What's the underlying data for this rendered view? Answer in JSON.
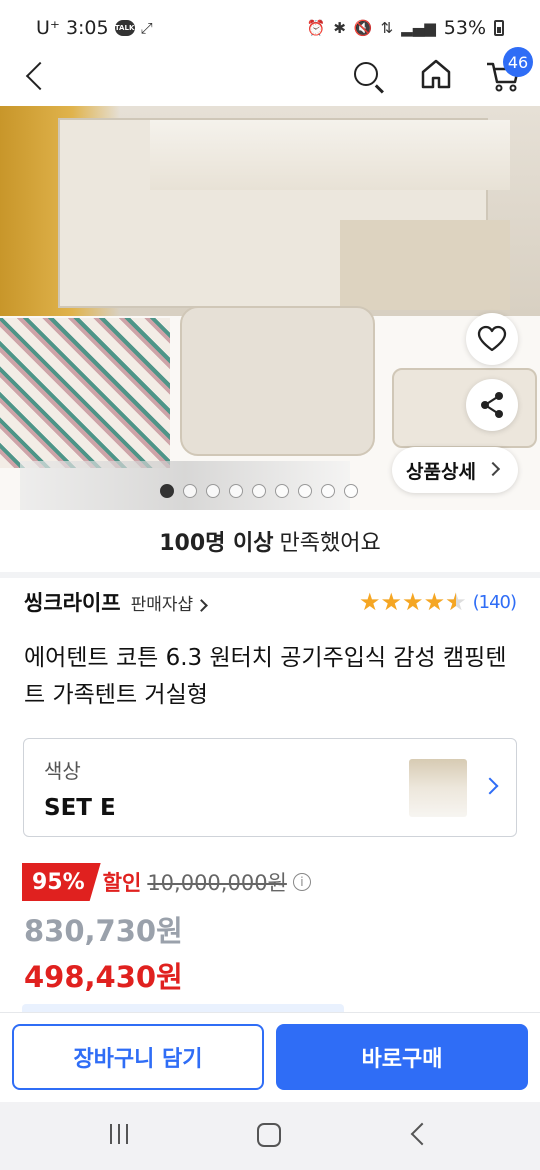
{
  "status_bar": {
    "carrier": "U⁺",
    "time": "3:05",
    "talk_icon_text": "TALK",
    "battery": "53%"
  },
  "header": {
    "cart_count": "46"
  },
  "gallery": {
    "detail_label": "상품상세",
    "dots_total": 9,
    "dots_active": 1
  },
  "satisfaction": {
    "bold": "100명 이상",
    "text": "만족했어요"
  },
  "seller": {
    "name": "씽크라이프",
    "link": "판매자샵",
    "rating": 4.5,
    "review_count": "(140)"
  },
  "product": {
    "title": "에어텐트 코튼 6.3 원터치 공기주입식 감성 캠핑텐트 가족텐트 거실형"
  },
  "option": {
    "label": "색상",
    "value": "SET E"
  },
  "price": {
    "discount_rate": "95%",
    "discount_label": "할인",
    "original": "10,000,000원",
    "sale": "830,730원",
    "final": "498,430원"
  },
  "buttons": {
    "add_to_cart": "장바구니 담기",
    "buy_now": "바로구매"
  },
  "colors": {
    "accent": "#2f6df6",
    "discount_red": "#e0211f",
    "star": "#f5a623"
  }
}
